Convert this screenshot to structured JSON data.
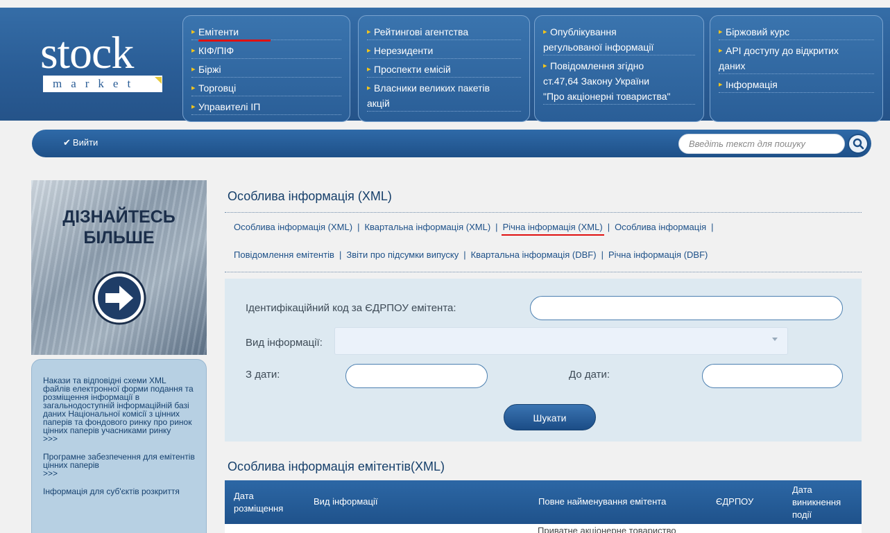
{
  "logo": {
    "word": "stock",
    "sub": "market"
  },
  "nav": {
    "col1": [
      "Емітенти",
      "КІФ/ПІФ",
      "Біржі",
      "Торговці",
      "Управителі ІП"
    ],
    "col2": [
      "Рейтингові агентства",
      "Нерезиденти",
      "Проспекти емісій",
      "Власники великих   пакетів",
      "акцій"
    ],
    "col3": [
      "Опублікування",
      "регульованої інформації",
      "Повідомлення згідно",
      "ст.47,64 Закону України",
      "\"Про акціонерні товариства\""
    ],
    "col4": [
      "Біржовий курс",
      "API доступу до відкритих",
      "даних",
      "Інформація"
    ]
  },
  "toolbar": {
    "logout_label": "Вийти",
    "search_placeholder": "Введіть текст для пошуку"
  },
  "sidebar": {
    "banner_line1": "ДІЗНАЙТЕСЬ",
    "banner_line2": "БІЛЬШЕ",
    "links": [
      {
        "text": "Накази та відповідні схеми XML файлів електронної форми подання та розміщення інформації в загальнодоступній інформаційній базі даних Національної комісії з цінних паперів та фондового ринку про ринок цінних паперів учасниками ринку",
        "more": ">>>"
      },
      {
        "text": "Програмне забезпечення для емітентів цінних паперів",
        "more": ">>>"
      },
      {
        "text": "Інформація для суб'єктів розкриття",
        "more": ""
      }
    ]
  },
  "main": {
    "title": "Особлива інформація (XML)",
    "tabs_row1": [
      "Особлива інформація (XML)",
      "Квартальна інформація (XML)",
      "Річна інформація (XML)",
      "Особлива інформація"
    ],
    "tabs_row2": [
      "Повідомлення емітентів",
      "Звіти про підсумки випуску",
      "Квартальна інформація (DBF)",
      "Річна інформація (DBF)"
    ],
    "separator": "|",
    "form": {
      "edrpou_label": "Ідентифікаційний код за ЄДРПОУ емітента:",
      "edrpou_value": "",
      "info_type_label": "Вид інформації:",
      "info_type_value": "",
      "date_from_label": "З дати:",
      "date_from_value": "",
      "date_to_label": "До дати:",
      "date_to_value": "",
      "submit_label": "Шукати"
    },
    "table_title": "Особлива інформація емітентів(XML)",
    "table": {
      "headers": [
        "Дата розміщення",
        "Вид інформації",
        "Повне найменування емітента",
        "ЄДРПОУ",
        "Дата виникнення події"
      ],
      "row1_emitent": "Приватне акціонерне товариство"
    }
  },
  "colors": {
    "header_blue": "#2a5d96",
    "accent_red": "#e01010",
    "bullet_yellow": "#f3c51b",
    "form_bg": "#dde9f1"
  }
}
